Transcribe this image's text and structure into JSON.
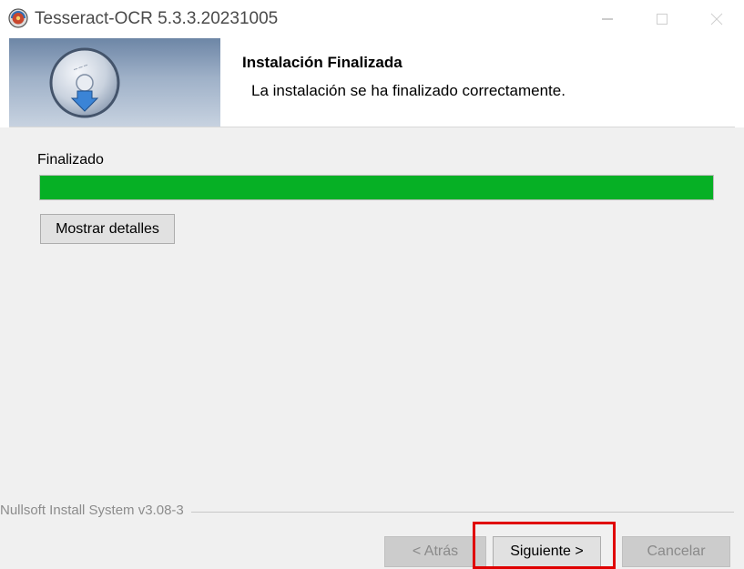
{
  "window": {
    "title": "Tesseract-OCR 5.3.3.20231005",
    "app_icon": "tesseract-app-icon",
    "controls": [
      "minimize-icon",
      "maximize-icon",
      "close-icon"
    ]
  },
  "header": {
    "icon": "installer-disk-icon",
    "title": "Instalación Finalizada",
    "subtitle": "La instalación se ha finalizado correctamente."
  },
  "content": {
    "status_label": "Finalizado",
    "progress_percent": 100,
    "progress_color": "#06b025",
    "details_button": "Mostrar detalles"
  },
  "footer": {
    "branding": "Nullsoft Install System v3.08-3",
    "back_button": "< Atrás",
    "next_button": "Siguiente >",
    "cancel_button": "Cancelar",
    "highlight_color": "#e00000"
  }
}
